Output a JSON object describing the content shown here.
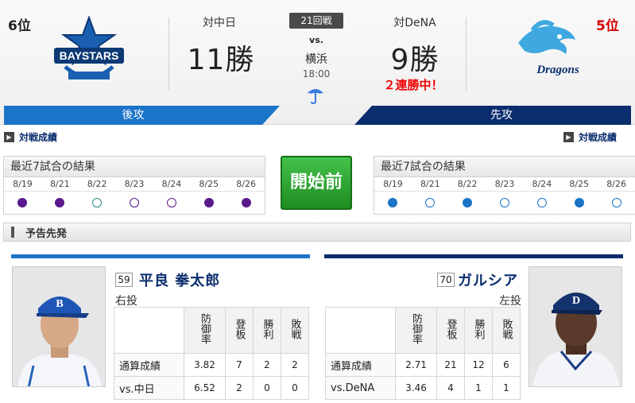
{
  "header": {
    "left_rank": "6位",
    "right_rank": "5位",
    "left_opponent": "対中日",
    "left_wins": "11勝",
    "right_opponent": "対DeNA",
    "right_wins": "9勝",
    "game_number": "21回戦",
    "vs": "vs.",
    "stadium": "横浜",
    "time": "18:00",
    "weather_icon": "umbrella-icon",
    "streak": "２連勝中！",
    "left_order": "後攻",
    "right_order": "先攻",
    "left_logo_text": "BAYSTARS",
    "right_logo_text": "Dragons",
    "colors": {
      "baystars_blue": "#1a74c7",
      "dragons_navy": "#0a2d6e",
      "streak_red": "#e00000"
    }
  },
  "links": {
    "left_record": "対戦成績",
    "right_record": "対戦成績"
  },
  "recent_left": {
    "title": "最近7試合の結果",
    "dates": [
      "8/19",
      "8/21",
      "8/22",
      "8/23",
      "8/24",
      "8/25",
      "8/26"
    ],
    "results": [
      "win",
      "win",
      "none",
      "loss",
      "loss",
      "win",
      "win"
    ]
  },
  "recent_right": {
    "title": "最近7試合の結果",
    "dates": [
      "8/19",
      "8/21",
      "8/22",
      "8/23",
      "8/24",
      "8/25",
      "8/26"
    ],
    "results": [
      "win",
      "loss",
      "win",
      "loss",
      "loss",
      "win",
      "loss"
    ]
  },
  "start_button": "開始前",
  "section_title": "予告先発",
  "pitcher_left": {
    "number": "59",
    "name": "平良 拳太郎",
    "hand": "右投",
    "headers": [
      "防御率",
      "登板",
      "勝利",
      "敗戦"
    ],
    "rows": [
      {
        "label": "通算成績",
        "values": [
          "3.82",
          "7",
          "2",
          "2"
        ]
      },
      {
        "label": "vs.中日",
        "values": [
          "6.52",
          "2",
          "0",
          "0"
        ]
      }
    ]
  },
  "pitcher_right": {
    "number": "70",
    "name": "ガルシア",
    "hand": "左投",
    "headers": [
      "防御率",
      "登板",
      "勝利",
      "敗戦"
    ],
    "rows": [
      {
        "label": "通算成績",
        "values": [
          "2.71",
          "21",
          "12",
          "6"
        ]
      },
      {
        "label": "vs.DeNA",
        "values": [
          "3.46",
          "4",
          "1",
          "1"
        ]
      }
    ]
  }
}
